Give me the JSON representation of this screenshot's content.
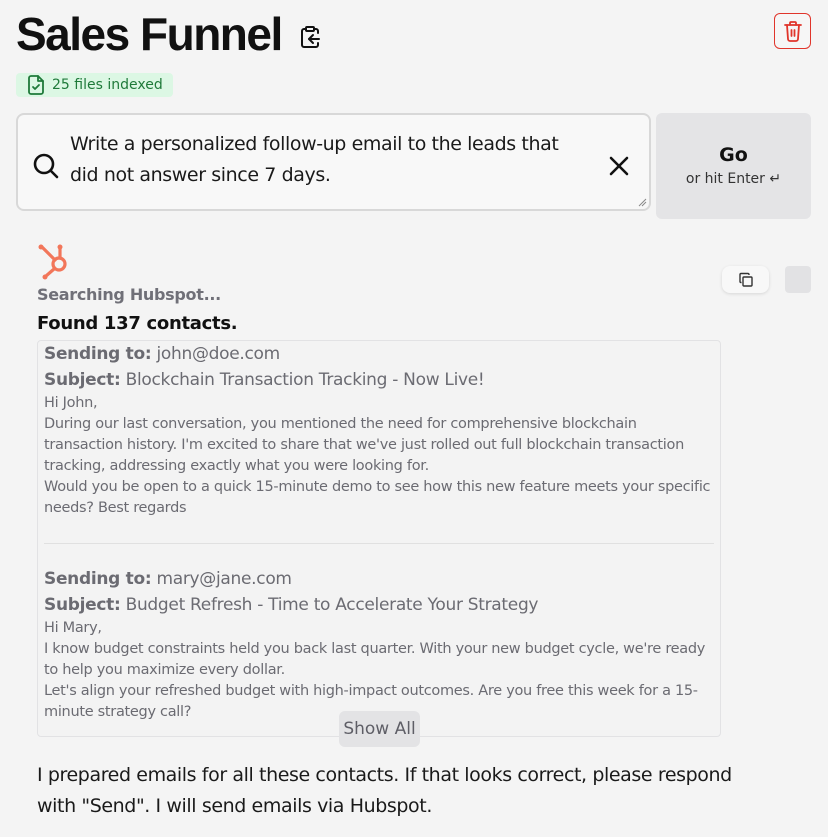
{
  "header": {
    "title": "Sales Funnel",
    "title_icon": "clipboard-arrow-icon",
    "delete_icon": "trash-icon"
  },
  "files_badge": {
    "icon": "file-check-icon",
    "label": "25 files indexed"
  },
  "search": {
    "icon": "search-icon",
    "value": "Write a personalized follow-up email to the leads that did not answer since 7 days.",
    "clear_icon": "close-icon"
  },
  "go_button": {
    "label": "Go",
    "sublabel": "or hit Enter ↵"
  },
  "result": {
    "source_icon": "hubspot-icon",
    "status": "Searching Hubspot...",
    "found": "Found 137 contacts.",
    "copy_icon": "copy-icon"
  },
  "emails": [
    {
      "to_label": "Sending to:",
      "to": "john@doe.com",
      "subject_label": "Subject:",
      "subject": "Blockchain Transaction Tracking - Now Live!",
      "body": [
        "Hi John,",
        "During our last conversation, you mentioned the need for comprehensive blockchain transaction history. I'm excited to share that we've just rolled out full blockchain transaction tracking, addressing exactly what you were looking for.",
        "Would you be open to a quick 15-minute demo to see how this new feature meets your specific needs? Best regards"
      ]
    },
    {
      "to_label": "Sending to:",
      "to": "mary@jane.com",
      "subject_label": "Subject:",
      "subject": "Budget Refresh - Time to Accelerate Your Strategy",
      "body": [
        "Hi Mary,",
        "I know budget constraints held you back last quarter. With your new budget cycle, we're ready to help you maximize every dollar.",
        "Let's align your refreshed budget with high-impact outcomes. Are you free this week for a 15-minute strategy call?"
      ]
    }
  ],
  "show_all_label": "Show All",
  "assistant_message": "I prepared emails for all these contacts. If that looks correct, please respond with \"Send\". I will send emails via Hubspot.",
  "colors": {
    "danger": "#e0352b",
    "success_bg": "#dcf7e4",
    "success_text": "#1f7a3a",
    "hubspot": "#f2765a"
  }
}
